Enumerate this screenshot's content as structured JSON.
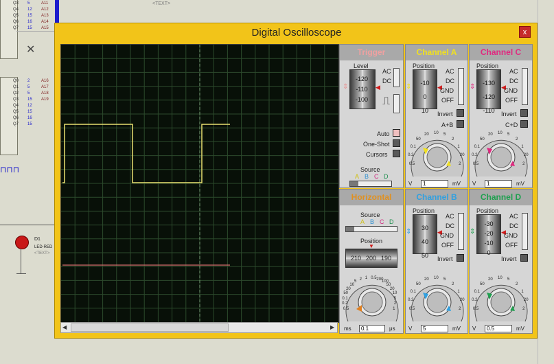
{
  "schematic": {
    "top_pins_left": [
      "Q3",
      "Q4",
      "Q5",
      "Q6",
      "Q7"
    ],
    "top_pins_mid": [
      "5",
      "12",
      "15",
      "16",
      "15"
    ],
    "top_pins_right": [
      "A11",
      "A12",
      "A13",
      "A14",
      "A15"
    ],
    "mid_pins_left": [
      "Q0",
      "Q1",
      "Q2",
      "Q3",
      "Q4",
      "Q5",
      "Q6",
      "Q7"
    ],
    "mid_pins_mid": [
      "2",
      "5",
      "5",
      "15",
      "12",
      "15",
      "16",
      "15"
    ],
    "mid_pins_right": [
      "A16",
      "A17",
      "A18",
      "A19"
    ],
    "text_tag_top": "<TEXT>",
    "led_ref": "D1",
    "led_name": "LED-RED",
    "led_text": "<TEXT>"
  },
  "window": {
    "title": "Digital Oscilloscope",
    "close_glyph": "x"
  },
  "trigger": {
    "header": "Trigger",
    "level_label": "Level",
    "level_ticks": [
      "-120",
      "-110",
      "-100"
    ],
    "ac": "AC",
    "dc": "DC",
    "auto": "Auto",
    "one_shot": "One-Shot",
    "cursors": "Cursors",
    "source_label": "Source",
    "source_options": [
      "A",
      "B",
      "C",
      "D"
    ]
  },
  "horizontal": {
    "header": "Horizontal",
    "source_label": "Source",
    "source_options": [
      "A",
      "B",
      "C",
      "D"
    ],
    "position_label": "Position",
    "position_ticks": [
      "210",
      "200",
      "190"
    ],
    "dial_ticks": [
      "0.5",
      "0.2",
      "0.1",
      "50",
      "20",
      "10",
      "5",
      "2",
      "1",
      "0.5",
      "200",
      "100",
      "50",
      "20",
      "10",
      "5",
      "2",
      "1"
    ],
    "value": "0.1",
    "unit_left": "ms",
    "unit_right": "μs"
  },
  "channels": {
    "a": {
      "header": "Channel A",
      "color": "#f0e020",
      "position_label": "Position",
      "ticks": [
        "-10",
        "0",
        "10"
      ],
      "ac": "AC",
      "dc": "DC",
      "gnd": "GND",
      "off": "OFF",
      "invert": "Invert",
      "combine": "A+B",
      "value": "1",
      "unit_left": "V",
      "unit_right": "mV",
      "dial_ticks": [
        "0.5",
        "0.2",
        "0.1",
        "50",
        "20",
        "10",
        "5",
        "2",
        "1",
        "20",
        "2"
      ]
    },
    "b": {
      "header": "Channel B",
      "color": "#30a0e0",
      "position_label": "Position",
      "ticks": [
        "30",
        "40",
        "50"
      ],
      "ac": "AC",
      "dc": "DC",
      "gnd": "GND",
      "off": "OFF",
      "invert": "Invert",
      "combine": "",
      "value": "5",
      "unit_left": "V",
      "unit_right": "mV",
      "dial_ticks": [
        "0.5",
        "0.2",
        "0.1",
        "50",
        "20",
        "10",
        "5",
        "2",
        "1",
        "20",
        "2"
      ]
    },
    "c": {
      "header": "Channel C",
      "color": "#e02a80",
      "position_label": "Position",
      "ticks": [
        "-130",
        "-120",
        "-110"
      ],
      "ac": "AC",
      "dc": "DC",
      "gnd": "GND",
      "off": "OFF",
      "invert": "Invert",
      "combine": "C+D",
      "value": "1",
      "unit_left": "V",
      "unit_right": "mV",
      "dial_ticks": [
        "0.5",
        "0.2",
        "0.1",
        "50",
        "20",
        "10",
        "5",
        "2",
        "1",
        "20",
        "2"
      ]
    },
    "d": {
      "header": "Channel D",
      "color": "#20a050",
      "position_label": "Position",
      "ticks": [
        "-30",
        "-20",
        "-10",
        "0"
      ],
      "ac": "AC",
      "dc": "DC",
      "gnd": "GND",
      "off": "OFF",
      "invert": "Invert",
      "combine": "",
      "value": "0.5",
      "unit_left": "V",
      "unit_right": "mV",
      "dial_ticks": [
        "0.5",
        "0.2",
        "0.1",
        "50",
        "20",
        "10",
        "5",
        "2",
        "1",
        "20",
        "2"
      ]
    }
  },
  "trace": {
    "channel_a_color": "#e8e070",
    "channel_c_color": "#d87070"
  }
}
